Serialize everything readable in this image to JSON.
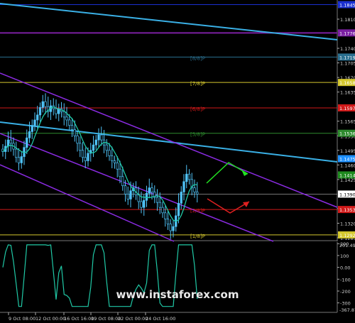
{
  "chart_data": [
    {
      "type": "candlestick",
      "ylim": [
        1.2855,
        1.186
      ],
      "price_ticks": [
        "1.1810",
        "1.1740",
        "1.1705",
        "1.1670",
        "1.1635",
        "1.1565",
        "1.1530",
        "1.1495",
        "1.1460",
        "1.1425",
        "1.1355",
        "1.1320",
        "1.1285"
      ],
      "price_labels": [
        {
          "text": "1.1845",
          "price": 1.1845,
          "color": "#1a2fd0"
        },
        {
          "text": "1.1776",
          "price": 1.1777,
          "color": "#7b1fa2"
        },
        {
          "text": "1.1719",
          "price": 1.1719,
          "color": "#2a6f8f"
        },
        {
          "text": "1.1658",
          "price": 1.1658,
          "color": "#d4c72e"
        },
        {
          "text": "1.1597",
          "price": 1.1597,
          "color": "#d11919"
        },
        {
          "text": "1.1536",
          "price": 1.1536,
          "color": "#2e8b2e"
        },
        {
          "text": "1.1475",
          "price": 1.1475,
          "color": "#1e90ff"
        },
        {
          "text": "1.1414",
          "price": 1.1436,
          "color": "#1f8a1f"
        },
        {
          "text": "1.1390",
          "price": 1.139,
          "color": "#ffffff"
        },
        {
          "text": "1.1353",
          "price": 1.1353,
          "color": "#d11919"
        },
        {
          "text": "1.1292",
          "price": 1.1292,
          "color": "#d4c72e"
        }
      ],
      "murrey_levels": [
        {
          "label": "[8/8]P",
          "price": 1.1719,
          "color": "#2a6f8f"
        },
        {
          "label": "[7/8]P",
          "price": 1.1658,
          "color": "#d4c72e"
        },
        {
          "label": "[6/8]P",
          "price": 1.1597,
          "color": "#d11919"
        },
        {
          "label": "[5/8]P",
          "price": 1.1536,
          "color": "#2e8b2e"
        },
        {
          "label": "[2/8]P",
          "price": 1.1353,
          "color": "#d11919"
        },
        {
          "label": "[1/8]P",
          "price": 1.1292,
          "color": "#d4c72e"
        }
      ],
      "x_ticks": [
        "9 Oct 08:00",
        "12 Oct 00:00",
        "16 Oct 16:00",
        "19 Oct 08:00",
        "22 Oct 00:00",
        "24 Oct 16:00"
      ],
      "closes": [
        1.1492,
        1.1505,
        1.152,
        1.1512,
        1.1498,
        1.1478,
        1.1465,
        1.148,
        1.1502,
        1.1525,
        1.154,
        1.1555,
        1.1568,
        1.158,
        1.1598,
        1.1612,
        1.16,
        1.1588,
        1.1602,
        1.1595,
        1.1583,
        1.1595,
        1.1588,
        1.1575,
        1.1568,
        1.1555,
        1.1545,
        1.153,
        1.1512,
        1.1495,
        1.1478,
        1.147,
        1.1488,
        1.1495,
        1.1508,
        1.152,
        1.1532,
        1.152,
        1.1508,
        1.1495,
        1.1482,
        1.147,
        1.1465,
        1.145,
        1.1432,
        1.141,
        1.139,
        1.1378,
        1.1398,
        1.1405,
        1.1388,
        1.1372,
        1.1358,
        1.1375,
        1.1392,
        1.1405,
        1.1395,
        1.1382,
        1.137,
        1.1358,
        1.1345,
        1.133,
        1.1318,
        1.1302,
        1.1312,
        1.1338,
        1.1368,
        1.1395,
        1.142,
        1.1438,
        1.1425,
        1.1405,
        1.1395,
        1.139
      ],
      "rsi": {
        "max_label": "201.498",
        "min_label": "-367.870",
        "ticks": [
          "200",
          "100",
          "0.00",
          "-100",
          "-200",
          "-300"
        ]
      },
      "watermark": "www.instaforex.com",
      "price_label_extra": "1.1425"
    }
  ]
}
